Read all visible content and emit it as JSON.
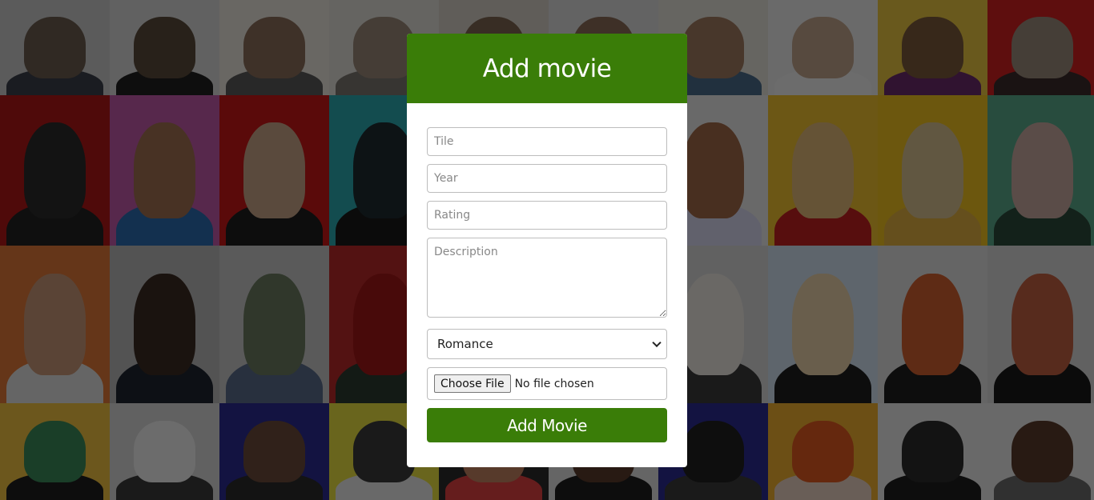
{
  "form": {
    "title": "Add movie",
    "title_placeholder": "Tile",
    "year_placeholder": "Year",
    "rating_placeholder": "Rating",
    "description_placeholder": "Description",
    "genre_selected": "Romance",
    "file_button_label": "Choose File",
    "file_status": "No file chosen",
    "submit_label": "Add Movie"
  },
  "colors": {
    "accent": "#3a7d08",
    "card_background": "#ffffff"
  },
  "backdrop_tiles": [
    {
      "bg": "#c9c9c9",
      "fig": "#6b5b4e",
      "body": "#3a3f4a"
    },
    {
      "bg": "#d8d8d8",
      "fig": "#5a4a3a",
      "body": "#202020"
    },
    {
      "bg": "#e8e4dc",
      "fig": "#8a6e5a",
      "body": "#5a5a5a"
    },
    {
      "bg": "#e0ded8",
      "fig": "#9a8878",
      "body": "#7a7570"
    },
    {
      "bg": "#d5cfc6",
      "fig": "#7c6450",
      "body": "#3b3b3b"
    },
    {
      "bg": "#dcdcdc",
      "fig": "#8a6c58",
      "body": "#2e2e2e"
    },
    {
      "bg": "#e2dfd8",
      "fig": "#a07a60",
      "body": "#4a6a8a"
    },
    {
      "bg": "#eaeaea",
      "fig": "#c0a48c",
      "body": "#f0f0f0"
    },
    {
      "bg": "#e8c640",
      "fig": "#7a5a3a",
      "body": "#6a2a6a"
    },
    {
      "bg": "#d02020",
      "fig": "#9a8a7a",
      "body": "#3a2a2a"
    },
    {
      "bg": "#b01818",
      "fig": "#2a2a2a",
      "body": "#222222"
    },
    {
      "bg": "#c05aa8",
      "fig": "#a07050",
      "body": "#2a6ab0"
    },
    {
      "bg": "#c81818",
      "fig": "#c8a488",
      "body": "#1e1e1e"
    },
    {
      "bg": "#2aa8b0",
      "fig": "#1e2a30",
      "body": "#1a1a1a"
    },
    {
      "bg": "#30b0b8",
      "fig": "#c8a080",
      "body": "#2a2a2a"
    },
    {
      "bg": "#e8e8e8",
      "fig": "#6a5040",
      "body": "#c03030"
    },
    {
      "bg": "#e8e8e8",
      "fig": "#a06848",
      "body": "#d8d8f0"
    },
    {
      "bg": "#f0c030",
      "fig": "#e0b878",
      "body": "#c02020"
    },
    {
      "bg": "#f0c020",
      "fig": "#d8c090",
      "body": "#e0b040"
    },
    {
      "bg": "#5aa88a",
      "fig": "#c8a8a0",
      "body": "#2a4a3a"
    },
    {
      "bg": "#e07838",
      "fig": "#c89878",
      "body": "#e0e0e0"
    },
    {
      "bg": "#b8b8b8",
      "fig": "#3a2a22",
      "body": "#1e2530"
    },
    {
      "bg": "#c8c8c8",
      "fig": "#6a7a60",
      "body": "#5a6a8a"
    },
    {
      "bg": "#b82828",
      "fig": "#a01818",
      "body": "#2a3a30"
    },
    {
      "bg": "#38a8c0",
      "fig": "#c89878",
      "body": "#2a2a2a"
    },
    {
      "bg": "#e0dcd6",
      "fig": "#5a4a3a",
      "body": "#7a4030"
    },
    {
      "bg": "#d8d8d8",
      "fig": "#eae6e0",
      "body": "#3a3a3a"
    },
    {
      "bg": "#d0e0f0",
      "fig": "#e8d0a8",
      "body": "#1e1e1e"
    },
    {
      "bg": "#e0e0e0",
      "fig": "#d06030",
      "body": "#1e1e1e"
    },
    {
      "bg": "#d8d8d8",
      "fig": "#c06040",
      "body": "#1a1a1a"
    },
    {
      "bg": "#f0c040",
      "fig": "#3a8a5a",
      "body": "#1e1e1e"
    },
    {
      "bg": "#d8d8d8",
      "fig": "#f0f0f0",
      "body": "#3a3a3a"
    },
    {
      "bg": "#2a2a90",
      "fig": "#6a4a3a",
      "body": "#2a2a2a"
    },
    {
      "bg": "#e8e040",
      "fig": "#3a3a3a",
      "body": "#e8e8e8"
    },
    {
      "bg": "#2a2a2a",
      "fig": "#c08060",
      "body": "#e04040"
    },
    {
      "bg": "#e0e0e0",
      "fig": "#5a3a2a",
      "body": "#1e1e1e"
    },
    {
      "bg": "#2a2a90",
      "fig": "#202020",
      "body": "#3a3a3a"
    },
    {
      "bg": "#f0b030",
      "fig": "#e05a20",
      "body": "#e8d0c0"
    },
    {
      "bg": "#e8e8e8",
      "fig": "#2a2a2a",
      "body": "#1e1e1e"
    },
    {
      "bg": "#e8e8e8",
      "fig": "#5a3a2a",
      "body": "#6a6a6a"
    }
  ]
}
